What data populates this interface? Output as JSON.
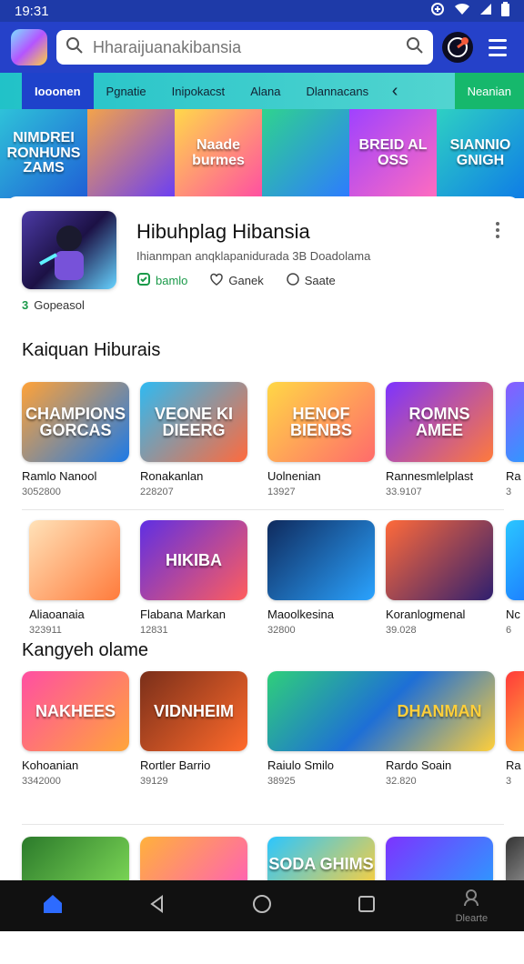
{
  "status": {
    "time": "19:31"
  },
  "search": {
    "placeholder": "Hharaijuanakibansia"
  },
  "tabs": [
    {
      "label": "Iooonen",
      "active": true
    },
    {
      "label": "Pgnatie"
    },
    {
      "label": "Inipokacst"
    },
    {
      "label": "Alana"
    },
    {
      "label": "Dlannacans"
    }
  ],
  "tab_pill": {
    "label": "Neanian"
  },
  "banner": [
    {
      "title": "NIMDREI\nRONHUNS\nZAMS"
    },
    {
      "title": ""
    },
    {
      "title": "Naade burmes"
    },
    {
      "title": ""
    },
    {
      "title": "BREID AL OSS"
    },
    {
      "title": "SIANNIO\nGNIGH"
    }
  ],
  "featured": {
    "title": "Hibuhplag Hibansia",
    "subtitle": "Ihianmpan anqklapanidurada 3B Doadolama",
    "actions": [
      {
        "label": "bamlo",
        "icon": "check-icon"
      },
      {
        "label": "Ganek",
        "icon": "heart-icon"
      },
      {
        "label": "Saate",
        "icon": "chat-icon"
      }
    ],
    "installs": "Gopeasol",
    "installs_prefix": "3"
  },
  "sections": {
    "popular": {
      "title": "Kaiquan Hiburais"
    },
    "category": {
      "title": "Kangyeh olame"
    }
  },
  "rows": {
    "row1": [
      {
        "name": "Ramlo Nanool",
        "count": "3052800",
        "art": "CHAMPIONS\nGORCAS"
      },
      {
        "name": "Ronakanlan",
        "count": "228207",
        "art": "VEONE KI\nDIEERG"
      },
      {
        "name": "Uolnenian",
        "count": "13927",
        "art": "HENOF\nBIENBS"
      },
      {
        "name": "Rannesmlelplast",
        "count": "33.9107",
        "art": "ROMNS\nAMEE"
      },
      {
        "name": "Ra",
        "count": "3",
        "art": ""
      }
    ],
    "row2": [
      {
        "name": "Aliaoanaia",
        "count": "323911",
        "art": ""
      },
      {
        "name": "Flabana Markan",
        "count": "12831",
        "art": "HIKIBA"
      },
      {
        "name": "Maoolkesina",
        "count": "32800",
        "art": ""
      },
      {
        "name": "Koranlogmenal",
        "count": "39.028",
        "art": ""
      },
      {
        "name": "Nc",
        "count": "6",
        "art": ""
      }
    ],
    "row3": [
      {
        "name": "Kohoanian",
        "count": "3342000",
        "art": "NAKHEES"
      },
      {
        "name": "Rortler Barrio",
        "count": "39129",
        "art": "VIDNHEIM"
      },
      {
        "name": "Raiulo Smilo",
        "count": "38925",
        "art": ""
      },
      {
        "name": "Rardo Soain",
        "count": "32.820",
        "art": "DHANMAN"
      },
      {
        "name": "Ra",
        "count": "3",
        "art": ""
      }
    ],
    "row4": [
      {
        "art": ""
      },
      {
        "art": ""
      },
      {
        "art": "SODA\nGHIMS"
      },
      {
        "art": ""
      },
      {
        "art": ""
      }
    ]
  },
  "navbar": {
    "profile_label": "Dlearte"
  },
  "colors": {
    "status_bg": "#1e3aa8",
    "appbar_bg": "#2541c9",
    "tab_active": "#1e42cb",
    "tabs_bg": "#21c2c8",
    "pill_bg": "#16b86c",
    "green": "#1b9a4a",
    "navbar_bg": "#111111"
  }
}
